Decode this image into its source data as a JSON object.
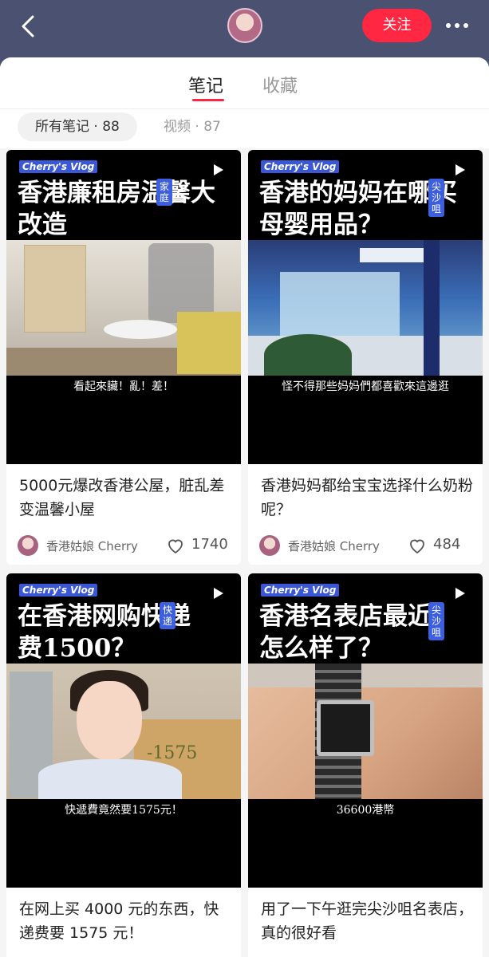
{
  "header": {
    "back_icon": "chevron-left-icon",
    "follow_label": "关注",
    "more_icon": "ellipsis-icon"
  },
  "tabs": [
    {
      "label": "笔记",
      "active": true
    },
    {
      "label": "收藏",
      "active": false
    }
  ],
  "filters": [
    {
      "label": "所有笔记 · 88",
      "active": true
    },
    {
      "label": "视频 · 87",
      "active": false
    }
  ],
  "notes": [
    {
      "vlog_tag": "Cherry's Vlog",
      "cover_title": "香港廉租房温馨大改造",
      "side_tag": "家庭",
      "subtitle": "看起來臟！亂！差！",
      "description": "5000元爆改香港公屋，脏乱差变温馨小屋",
      "author": "香港姑娘 Cherry",
      "likes": "1740"
    },
    {
      "vlog_tag": "Cherry's Vlog",
      "cover_title": "香港的妈妈在哪买母婴用品？",
      "side_tag": "尖沙咀",
      "subtitle": "怪不得那些妈妈們都喜歡來這邊逛",
      "description": "香港妈妈都给宝宝选择什么奶粉呢？",
      "author": "香港姑娘 Cherry",
      "likes": "484"
    },
    {
      "vlog_tag": "Cherry's Vlog",
      "cover_title": "在香港网购快递费1500？",
      "side_tag": "快递",
      "subtitle": "快遞費竟然要1575元！",
      "overlay_number": "-1575",
      "description": "在网上买 4000 元的东西，快递费要 1575 元！"
    },
    {
      "vlog_tag": "Cherry's Vlog",
      "cover_title": "香港名表店最近怎么样了？",
      "side_tag": "尖沙咀",
      "subtitle": "36600港幣",
      "description": "用了一下午逛完尖沙咀名表店，真的很好看"
    }
  ]
}
